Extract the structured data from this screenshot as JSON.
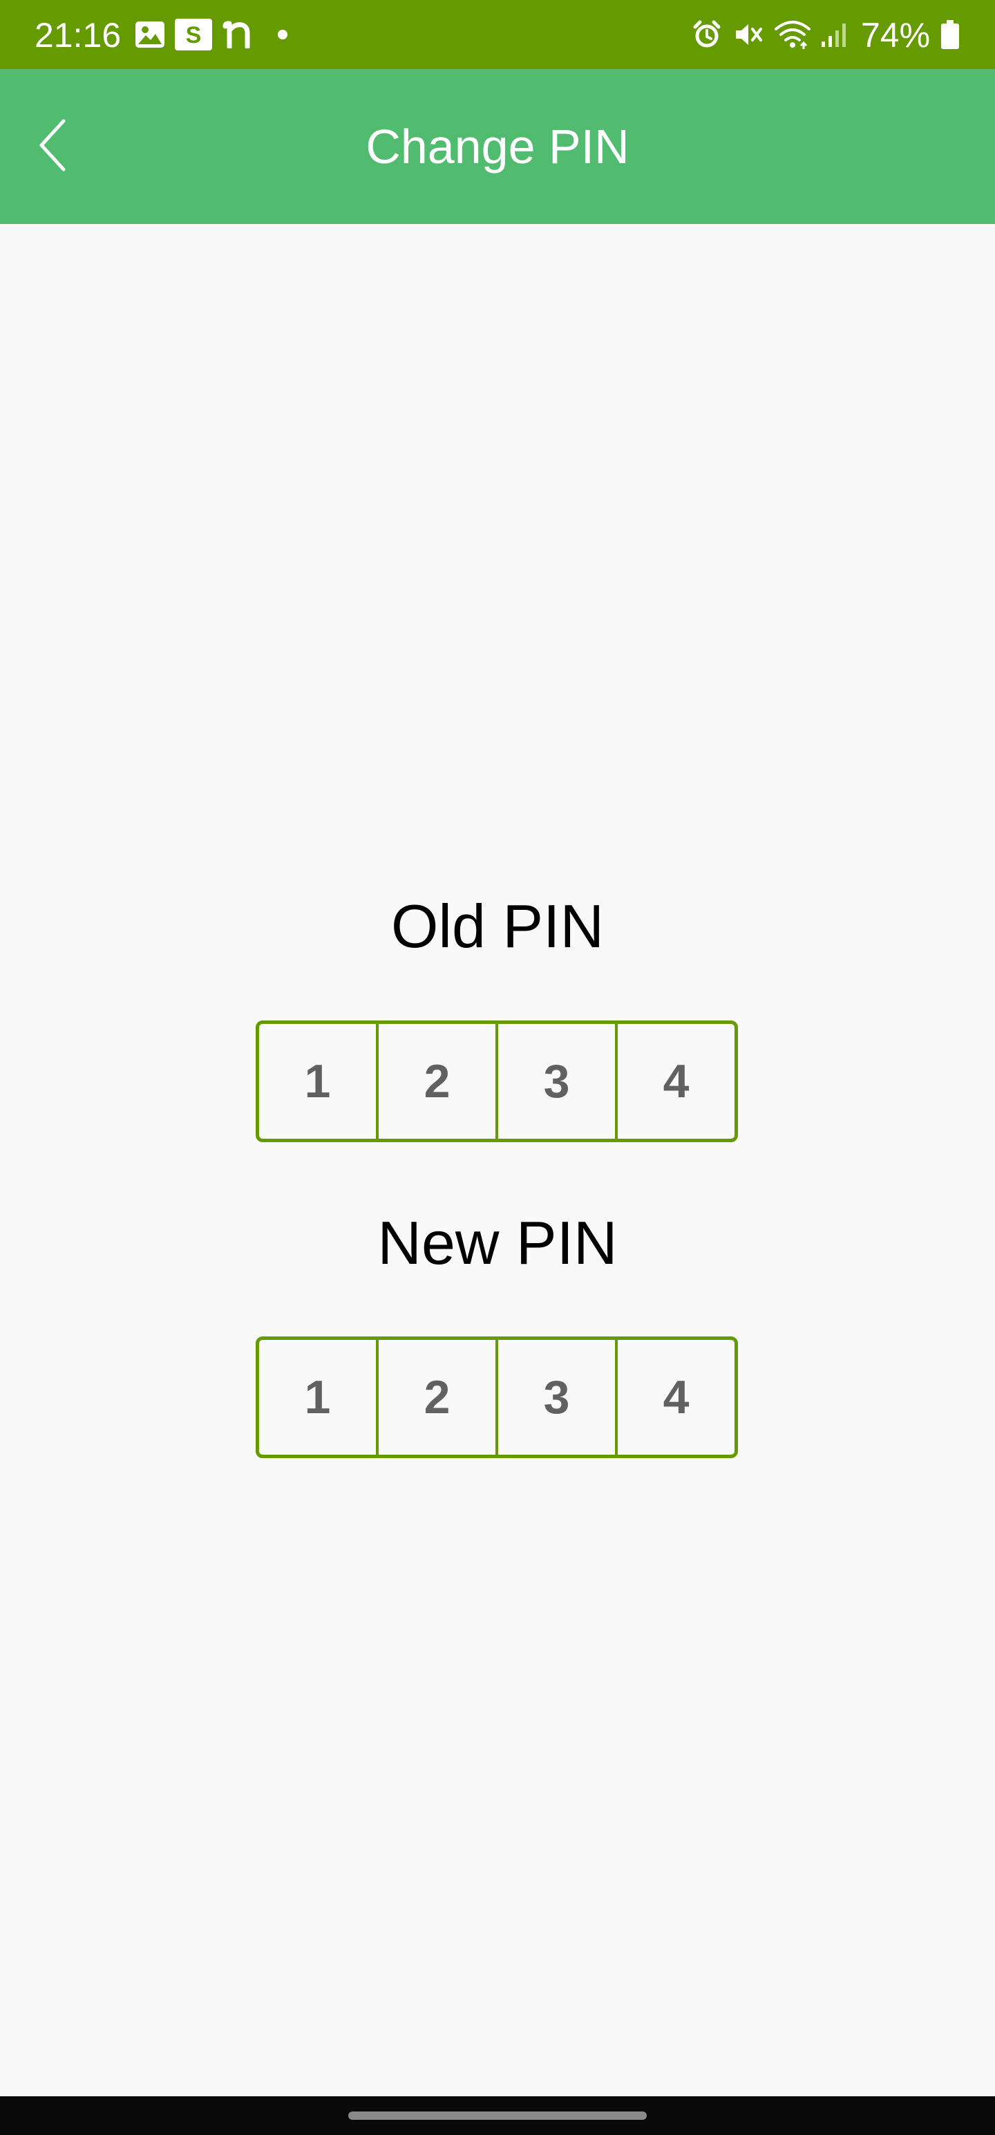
{
  "status_bar": {
    "time": "21:16",
    "battery": "74%",
    "left_icons": [
      "gallery-icon",
      "s-app-icon",
      "n-app-icon",
      "dot-icon"
    ],
    "right_icons": [
      "alarm-icon",
      "mute-icon",
      "wifi-icon",
      "signal-icon",
      "battery-icon"
    ]
  },
  "app_bar": {
    "title": "Change PIN",
    "back_icon": "chevron-left-icon"
  },
  "old_pin": {
    "label": "Old PIN",
    "digits": [
      "1",
      "2",
      "3",
      "4"
    ]
  },
  "new_pin": {
    "label": "New PIN",
    "digits": [
      "1",
      "2",
      "3",
      "4"
    ]
  },
  "colors": {
    "status_bar": "#659b00",
    "app_bar": "#51bb6f",
    "accent_border": "#659b00",
    "background": "#f9f9f9",
    "digit_text": "#616161"
  }
}
